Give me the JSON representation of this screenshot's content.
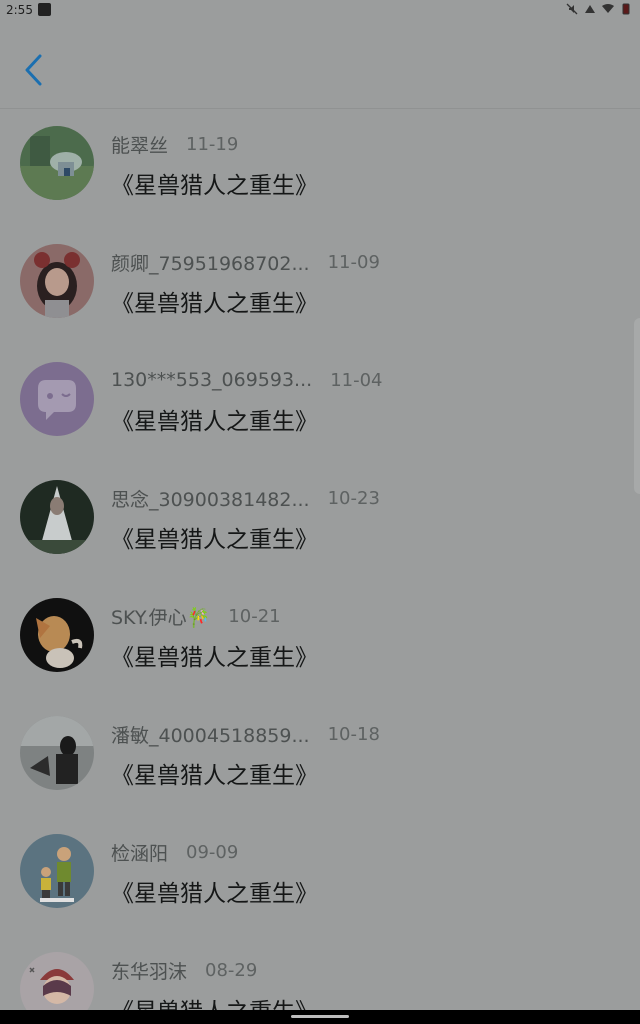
{
  "status_bar": {
    "time": "2:55",
    "icons": [
      "app-square-icon",
      "mute-icon",
      "signal-icon",
      "wifi-icon",
      "battery-icon"
    ]
  },
  "header": {
    "back_icon": "chevron-left-icon",
    "accent_color": "#1b6fb0"
  },
  "rows": [
    {
      "username": "能翠丝",
      "date": "11-19",
      "comment": "《星兽猎人之重生》",
      "avatar": "landscape-avatar"
    },
    {
      "username": "颜卿_75951968702...",
      "date": "11-09",
      "comment": "《星兽猎人之重生》",
      "avatar": "anime-girl-avatar"
    },
    {
      "username": "130***553_069593...",
      "date": "11-04",
      "comment": "《星兽猎人之重生》",
      "avatar": "chat-bubble-avatar"
    },
    {
      "username": "思念_30900381482...",
      "date": "10-23",
      "comment": "《星兽猎人之重生》",
      "avatar": "white-dress-avatar"
    },
    {
      "username": "SKY.伊心🎋",
      "date": "10-21",
      "comment": "《星兽猎人之重生》",
      "avatar": "cartoon-character-avatar"
    },
    {
      "username": "潘敏_40004518859...",
      "date": "10-18",
      "comment": "《星兽猎人之重生》",
      "avatar": "couple-photo-avatar"
    },
    {
      "username": "检涵阳",
      "date": "09-09",
      "comment": "《星兽猎人之重生》",
      "avatar": "father-son-cartoon-avatar"
    },
    {
      "username": "东华羽沫",
      "date": "08-29",
      "comment": "《星兽猎人之重生》",
      "avatar": "cute-girl-avatar"
    }
  ]
}
